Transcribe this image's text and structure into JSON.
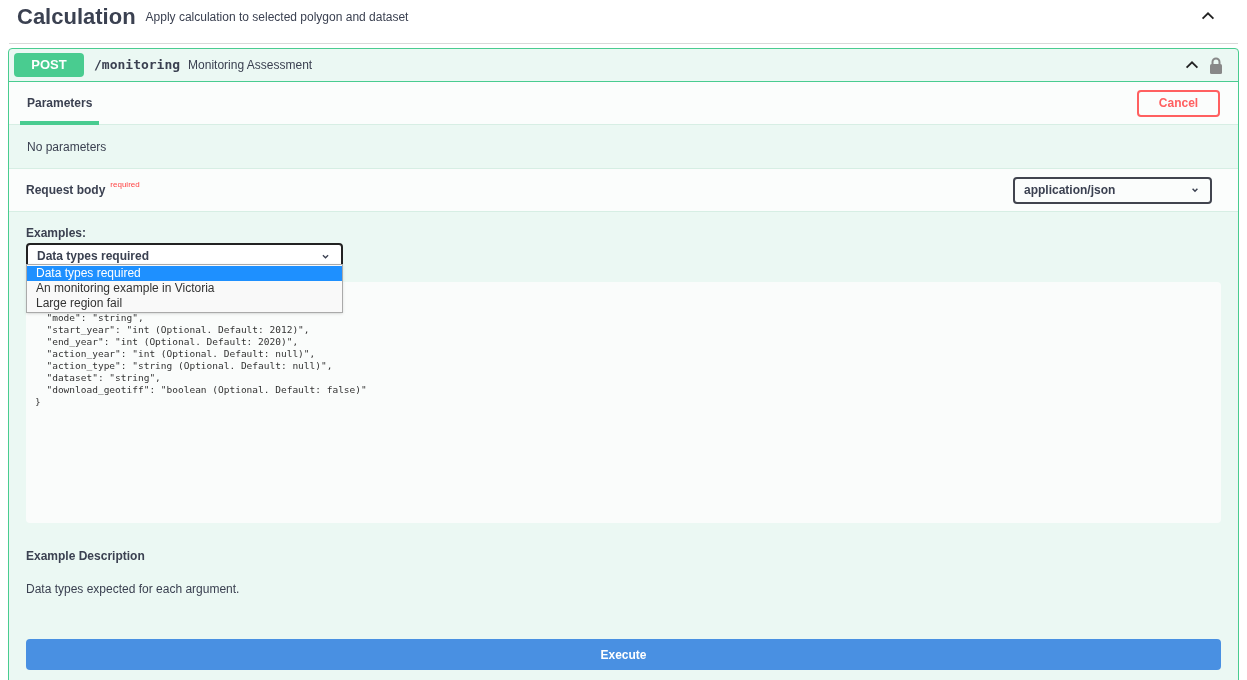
{
  "section": {
    "title": "Calculation",
    "description": "Apply calculation to selected polygon and dataset",
    "expanded": true
  },
  "operation": {
    "method": "POST",
    "path": "/monitoring",
    "summary": "Monitoring Assessment",
    "expanded": true,
    "locked": true
  },
  "tabs": [
    {
      "label": "Parameters",
      "selected": true
    }
  ],
  "cancel_button": "Cancel",
  "parameters_message": "No parameters",
  "request_body": {
    "label": "Request body",
    "required_tag": "required",
    "content_type": "application/json"
  },
  "examples": {
    "label": "Examples:",
    "value": "Data types required",
    "expanded": true,
    "options": [
      {
        "label": "Data types required",
        "selected": true
      },
      {
        "label": "An monitoring example in Victoria",
        "selected": false
      },
      {
        "label": "Large region fail",
        "selected": false
      }
    ]
  },
  "code_lines": [
    "  \"mode\": \"string\",",
    "  \"start_year\": \"int (Optional. Default: 2012)\",",
    "  \"end_year\": \"int (Optional. Default: 2020)\",",
    "  \"action_year\": \"int (Optional. Default: null)\",",
    "  \"action_type\": \"string (Optional. Default: null)\",",
    "  \"dataset\": \"string\",",
    "  \"download_geotiff\": \"boolean (Optional. Default: false)\"",
    "}"
  ],
  "example_description": {
    "title": "Example Description",
    "text": "Data types expected for each argument."
  },
  "execute_button": "Execute"
}
